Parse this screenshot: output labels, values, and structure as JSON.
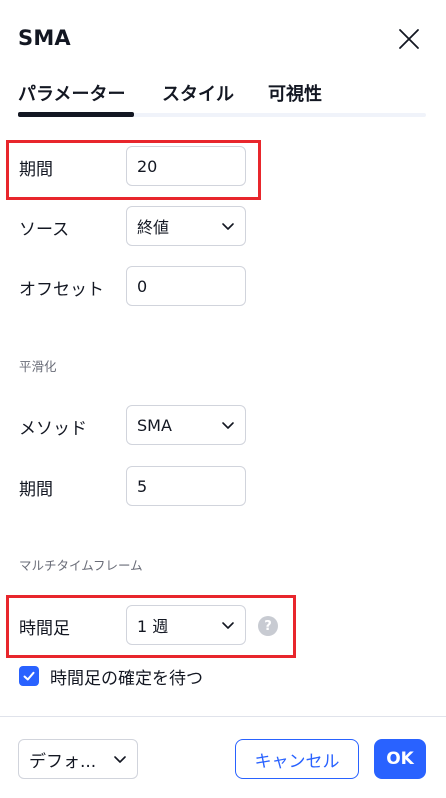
{
  "header": {
    "title": "SMA"
  },
  "tabs": [
    {
      "label": "パラメーター",
      "active": true
    },
    {
      "label": "スタイル",
      "active": false
    },
    {
      "label": "可視性",
      "active": false
    }
  ],
  "params": {
    "period": {
      "label": "期間",
      "value": "20"
    },
    "source": {
      "label": "ソース",
      "value": "終値"
    },
    "offset": {
      "label": "オフセット",
      "value": "0"
    }
  },
  "smoothing": {
    "section_title": "平滑化",
    "method": {
      "label": "メソッド",
      "value": "SMA"
    },
    "period": {
      "label": "期間",
      "value": "5"
    }
  },
  "multi_timeframe": {
    "section_title": "マルチタイムフレーム",
    "timeframe": {
      "label": "時間足",
      "value": "1 週"
    },
    "help_icon": "?",
    "wait_confirm": {
      "label": "時間足の確定を待つ",
      "checked": true
    }
  },
  "footer": {
    "defaults_label": "デフォ...",
    "cancel_label": "キャンセル",
    "ok_label": "OK"
  },
  "colors": {
    "accent": "#2962ff",
    "highlight": "#e8262c",
    "text": "#131722",
    "muted": "#6a6d78",
    "border": "#d1d4dc"
  },
  "icons": {
    "close": "close-icon",
    "chevron": "chevron-down-icon",
    "help": "help-icon",
    "check": "check-icon"
  }
}
